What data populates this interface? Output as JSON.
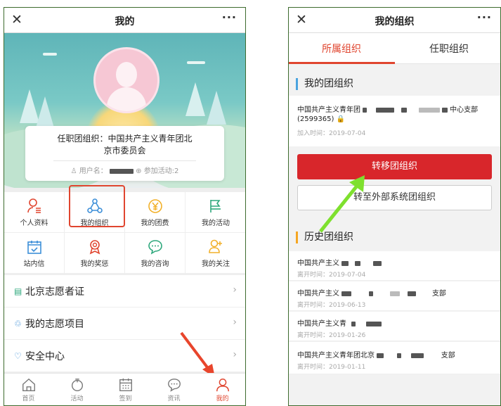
{
  "left": {
    "topbar": {
      "close": "✕",
      "title": "我的",
      "more": "···"
    },
    "profile": {
      "org_line1": "任职团组织：中国共产主义青年团北",
      "org_line2": "京市委员会",
      "user_prefix": "用户名：",
      "activities": "参加活动:2"
    },
    "grid": [
      {
        "label": "个人资料",
        "icon": "person-doc-icon",
        "color": "#e0452f"
      },
      {
        "label": "我的组织",
        "icon": "org-tree-icon",
        "color": "#3d8fd8"
      },
      {
        "label": "我的团费",
        "icon": "yen-coin-icon",
        "color": "#f2b12b"
      },
      {
        "label": "我的活动",
        "icon": "flag-icon",
        "color": "#2fa87d"
      },
      {
        "label": "站内信",
        "icon": "calendar-check-icon",
        "color": "#3d8fd8"
      },
      {
        "label": "我的奖惩",
        "icon": "medal-icon",
        "color": "#e0452f"
      },
      {
        "label": "我的咨询",
        "icon": "chat-bubble-icon",
        "color": "#2fa87d"
      },
      {
        "label": "我的关注",
        "icon": "person-plus-icon",
        "color": "#f2b12b"
      }
    ],
    "menu": [
      {
        "label": "北京志愿者证",
        "icon": "card-icon",
        "color": "#2fa87d",
        "arrow": "›"
      },
      {
        "label": "我的志愿项目",
        "icon": "volunteer-icon",
        "color": "#3d8fd8",
        "arrow": "›"
      },
      {
        "label": "安全中心",
        "icon": "heart-shield-icon",
        "color": "#3d8fd8",
        "arrow": "›"
      }
    ],
    "tabbar": [
      {
        "label": "首页",
        "icon": "home-icon"
      },
      {
        "label": "活动",
        "icon": "activity-icon"
      },
      {
        "label": "签到",
        "icon": "checkin-calendar-icon"
      },
      {
        "label": "资讯",
        "icon": "news-chat-icon"
      },
      {
        "label": "我的",
        "icon": "me-icon",
        "active": true
      }
    ]
  },
  "right": {
    "topbar": {
      "close": "✕",
      "title": "我的组织",
      "more": "···"
    },
    "tabs": [
      "所属组织",
      "任职组织"
    ],
    "my_org_title": "我的团组织",
    "my_org": {
      "prefix": "中国共产主义青年团",
      "suffix": "中心支部",
      "code": "(2599365)",
      "join_time": "加入时间：2019-07-04"
    },
    "btn_transfer": "转移团组织",
    "btn_external": "转至外部系统团组织",
    "history_title": "历史团组织",
    "history": [
      {
        "prefix": "中国共产主义",
        "suffix": "",
        "time": "离开时间：2019-07-04"
      },
      {
        "prefix": "中国共产主义",
        "suffix": "支部",
        "time": "离开时间：2019-06-13"
      },
      {
        "prefix": "中国共产主义青",
        "suffix": "",
        "time": "离开时间：2019-01-26"
      },
      {
        "prefix": "中国共产主义青年团北京",
        "suffix": "支部",
        "time": "离开时间：2019-01-11"
      }
    ]
  },
  "colors": {
    "accent_red": "#e0452f",
    "button_red": "#d8262b",
    "annotation_arrow_left": "#e8452c",
    "annotation_arrow_right": "#7ee02e"
  }
}
